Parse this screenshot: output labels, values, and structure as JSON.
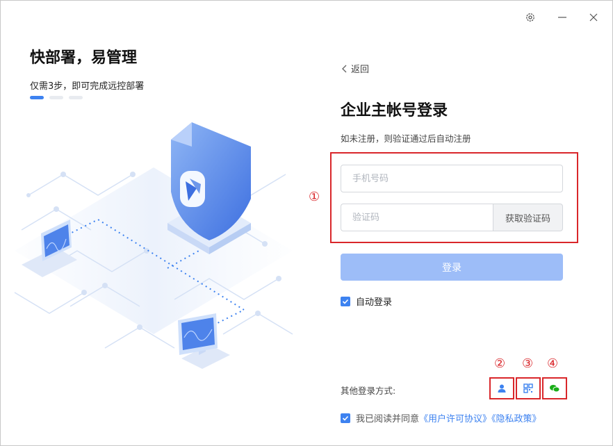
{
  "window": {
    "controls": [
      "gear-icon",
      "minimize-icon",
      "close-icon"
    ]
  },
  "left": {
    "title": "快部署，易管理",
    "subtitle": "仅需3步，即可完成远控部署",
    "steps_total": 3,
    "steps_active": 1
  },
  "form": {
    "back_label": "返回",
    "title": "企业主帐号登录",
    "hint": "如未注册，则验证通过后自动注册",
    "phone_placeholder": "手机号码",
    "code_placeholder": "验证码",
    "get_code_label": "获取验证码",
    "login_label": "登录",
    "auto_login_label": "自动登录",
    "auto_login_checked": true
  },
  "other_login": {
    "label": "其他登录方式:",
    "methods": [
      {
        "icon": "user-icon",
        "marker": "②"
      },
      {
        "icon": "qrcode-icon",
        "marker": "③"
      },
      {
        "icon": "wechat-icon",
        "marker": "④"
      }
    ]
  },
  "agreement": {
    "checked": true,
    "prefix": "我已阅读并同意",
    "license_link": "《用户许可协议》",
    "privacy_link": "《隐私政策》"
  },
  "annotations": {
    "form_marker": "①"
  },
  "colors": {
    "accent": "#3d82f0",
    "login_button_disabled": "#9dbdf8",
    "annotation_red": "#d9262a"
  }
}
